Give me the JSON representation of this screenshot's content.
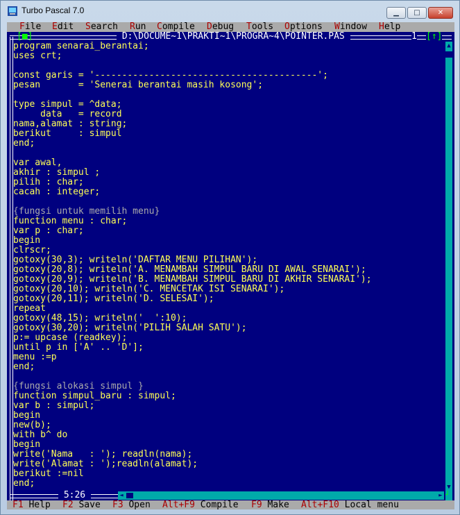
{
  "window": {
    "title": "Turbo Pascal 7.0"
  },
  "menu": {
    "items": [
      {
        "hotkey": "F",
        "rest": "ile"
      },
      {
        "hotkey": "E",
        "rest": "dit"
      },
      {
        "hotkey": "S",
        "rest": "earch"
      },
      {
        "hotkey": "R",
        "rest": "un"
      },
      {
        "hotkey": "C",
        "rest": "ompile"
      },
      {
        "hotkey": "D",
        "rest": "ebug"
      },
      {
        "hotkey": "T",
        "rest": "ools"
      },
      {
        "hotkey": "O",
        "rest": "ptions"
      },
      {
        "hotkey": "W",
        "rest": "indow"
      },
      {
        "hotkey": "H",
        "rest": "elp"
      }
    ]
  },
  "editor": {
    "file_path": " D:\\DOCUME~1\\PRAKTI~1\\PROGRA~4\\POINTER.PAS ",
    "close_box": "[■]",
    "window_number": "1",
    "zoom_box": "[↑]",
    "cursor_position": " 5:26 ",
    "code_lines": [
      "program senarai_berantai;",
      "uses crt;",
      "",
      "const garis = '-----------------------------------------';",
      "pesan       = 'Senerai berantai masih kosong';",
      "",
      "type simpul = ^data;",
      "     data   = record",
      "nama,alamat : string;",
      "berikut     : simpul",
      "end;",
      "",
      "var awal,",
      "akhir : simpul ;",
      "pilih : char;",
      "cacah : integer;",
      "",
      "{fungsi untuk memilih menu}",
      "function menu : char;",
      "var p : char;",
      "begin",
      "clrscr;",
      "gotoxy(30,3); writeln('DAFTAR MENU PILIHAN');",
      "gotoxy(20,8); writeln('A. MENAMBAH SIMPUL BARU DI AWAL SENARAI');",
      "gotoxy(20,9); writeln('B. MENAMBAH SIMPUL BARU DI AKHIR SENARAI');",
      "gotoxy(20,10); writeln('C. MENCETAK ISI SENARAI');",
      "gotoxy(20,11); writeln('D. SELESAI');",
      "repeat",
      "gotoxy(48,15); writeln('  ':10);",
      "gotoxy(30,20); writeln('PILIH SALAH SATU');",
      "p:= upcase (readkey);",
      "until p in ['A' .. 'D'];",
      "menu :=p",
      "end;",
      "",
      "{fungsi alokasi simpul }",
      "function simpul_baru : simpul;",
      "var b : simpul;",
      "begin",
      "new(b);",
      "with b^ do",
      "begin",
      "write('Nama   : '); readln(nama);",
      "write('Alamat : ');readln(alamat);",
      "berikut :=nil",
      "end;"
    ]
  },
  "status": {
    "items": [
      {
        "key": "F1",
        "label": " Help"
      },
      {
        "key": "F2",
        "label": " Save"
      },
      {
        "key": "F3",
        "label": " Open"
      },
      {
        "key": "Alt+F9",
        "label": " Compile"
      },
      {
        "key": "F9",
        "label": " Make"
      },
      {
        "key": "Alt+F10",
        "label": " Local menu"
      }
    ]
  },
  "colors": {
    "background": "#00007f",
    "text": "#ffff55",
    "comment": "#aaaaaa",
    "menu_bar": "#aaaaaa",
    "hotkey": "#aa0000",
    "scrollbar": "#00aaaa",
    "active_box": "#00ff00"
  }
}
